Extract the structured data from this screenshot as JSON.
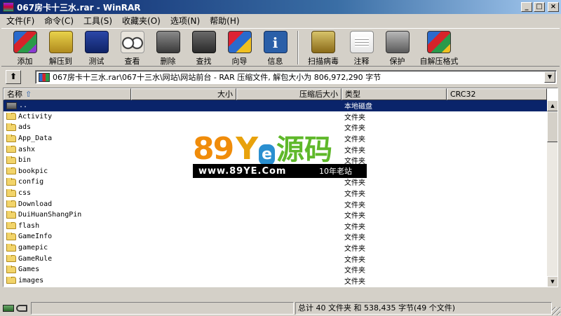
{
  "window": {
    "title": "067房卡十三水.rar - WinRAR",
    "minimize": "_",
    "maximize": "□",
    "close": "×"
  },
  "menu": [
    "文件(F)",
    "命令(C)",
    "工具(S)",
    "收藏夹(O)",
    "选项(N)",
    "帮助(H)"
  ],
  "toolbar": [
    {
      "label": "添加",
      "icon": "add-archive-icon"
    },
    {
      "label": "解压到",
      "icon": "extract-to-icon"
    },
    {
      "label": "测试",
      "icon": "test-icon"
    },
    {
      "label": "查看",
      "icon": "view-icon"
    },
    {
      "label": "删除",
      "icon": "delete-icon"
    },
    {
      "label": "查找",
      "icon": "find-icon"
    },
    {
      "label": "向导",
      "icon": "wizard-icon"
    },
    {
      "label": "信息",
      "icon": "info-icon"
    },
    {
      "label": "扫描病毒",
      "icon": "scan-virus-icon"
    },
    {
      "label": "注释",
      "icon": "comment-icon"
    },
    {
      "label": "保护",
      "icon": "protect-icon"
    },
    {
      "label": "自解压格式",
      "icon": "sfx-icon"
    }
  ],
  "path": {
    "up_glyph": "⬆",
    "text": "067房卡十三水.rar\\067十三水\\网站\\网站前台 - RAR 压缩文件, 解包大小为 806,972,290 字节",
    "dropdown_glyph": "▼"
  },
  "columns": {
    "name": "名称",
    "size": "大小",
    "packed": "压缩后大小",
    "type": "类型",
    "crc": "CRC32"
  },
  "rows": [
    {
      "name": "..",
      "type": "本地磁盘",
      "kind": "drive",
      "selected": true
    },
    {
      "name": "Activity",
      "type": "文件夹",
      "kind": "folder"
    },
    {
      "name": "ads",
      "type": "文件夹",
      "kind": "folder"
    },
    {
      "name": "App_Data",
      "type": "文件夹",
      "kind": "folder"
    },
    {
      "name": "ashx",
      "type": "文件夹",
      "kind": "folder"
    },
    {
      "name": "bin",
      "type": "文件夹",
      "kind": "folder"
    },
    {
      "name": "bookpic",
      "type": "文件夹",
      "kind": "folder"
    },
    {
      "name": "config",
      "type": "文件夹",
      "kind": "folder"
    },
    {
      "name": "css",
      "type": "文件夹",
      "kind": "folder"
    },
    {
      "name": "Download",
      "type": "文件夹",
      "kind": "folder"
    },
    {
      "name": "DuiHuanShangPin",
      "type": "文件夹",
      "kind": "folder"
    },
    {
      "name": "flash",
      "type": "文件夹",
      "kind": "folder"
    },
    {
      "name": "GameInfo",
      "type": "文件夹",
      "kind": "folder"
    },
    {
      "name": "gamepic",
      "type": "文件夹",
      "kind": "folder"
    },
    {
      "name": "GameRule",
      "type": "文件夹",
      "kind": "folder"
    },
    {
      "name": "Games",
      "type": "文件夹",
      "kind": "folder"
    },
    {
      "name": "images",
      "type": "文件夹",
      "kind": "folder"
    }
  ],
  "watermark": {
    "digits": "89",
    "y": "Y",
    "e": "e",
    "cn": "源码",
    "url": "www.89YE.Com",
    "slogan": "10年老站"
  },
  "status": {
    "left": "",
    "right": "总计 40 文件夹 和 538,435 字节(49 个文件)"
  },
  "colors": {
    "title_gradient_start": "#0a246a",
    "selection": "#0a246a",
    "face": "#d4d0c8"
  }
}
